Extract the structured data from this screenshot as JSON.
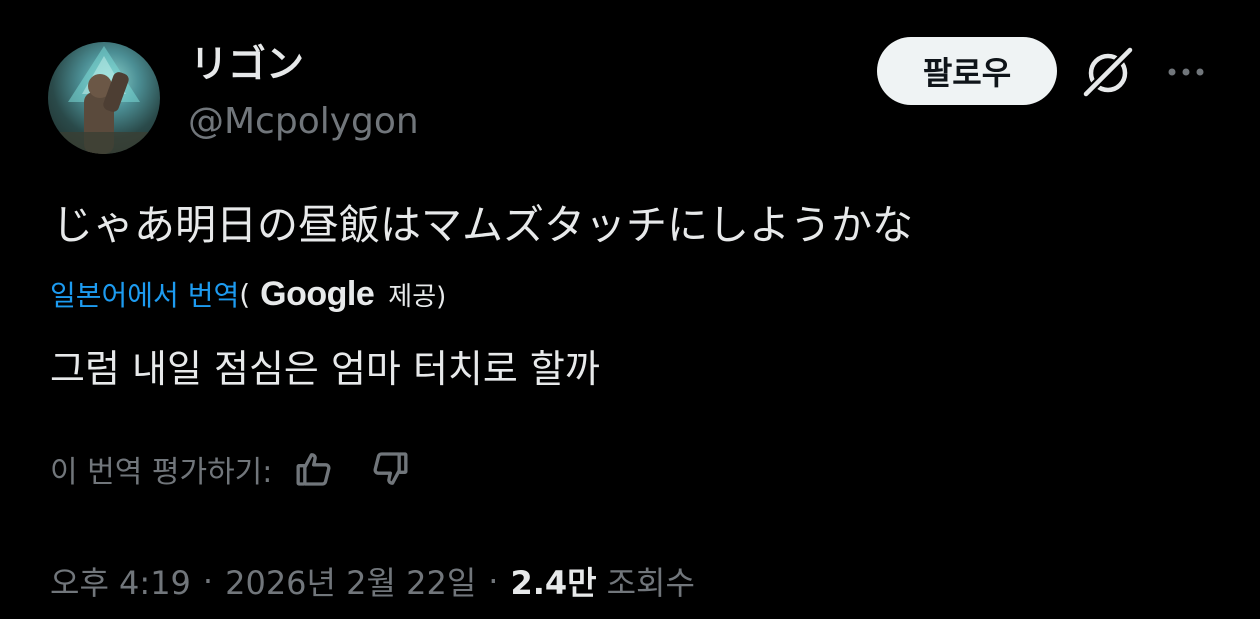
{
  "author": {
    "display_name": "リゴン",
    "handle": "@Mcpolygon"
  },
  "header": {
    "follow_label": "팔로우",
    "grok_icon": "grok-slash-icon",
    "more_icon": "more-horizontal-icon"
  },
  "tweet": {
    "text": "じゃあ明日の昼飯はマムズタッチにしようかな",
    "translate_link": "일본어에서 번역",
    "paren_open": "(",
    "google": "Google",
    "provided": "제공)",
    "translated_text": "그럼 내일 점심은 엄마 터치로 할까"
  },
  "rating": {
    "label": "이 번역 평가하기:",
    "thumbs_up_icon": "thumbs-up-icon",
    "thumbs_down_icon": "thumbs-down-icon"
  },
  "meta": {
    "time": "오후 4:19",
    "separator": "·",
    "date": "2026년 2월 22일",
    "views_count": "2.4만",
    "views_label": "조회수"
  },
  "colors": {
    "background": "#000000",
    "primary_text": "#e7e9ea",
    "secondary_text": "#71767b",
    "link": "#1d9bf0",
    "follow_bg": "#eff3f4"
  }
}
